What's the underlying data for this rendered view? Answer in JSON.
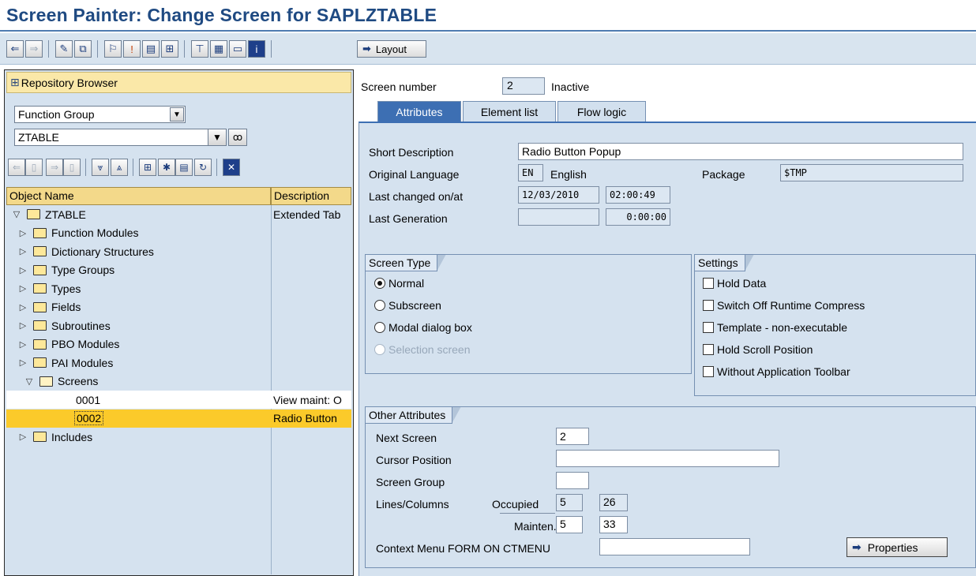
{
  "window": {
    "title": "Screen Painter: Change Screen for SAPLZTABLE"
  },
  "toolbar": {
    "icons": [
      "back-arrow-icon",
      "forward-arrow-icon",
      "display-change-icon",
      "other-object-icon",
      "activate-icon",
      "where-used-icon",
      "check-icon",
      "object-list-icon",
      "navigate-icon",
      "hierarchy-icon",
      "screen-layout-icon",
      "element-list-icon",
      "info-icon"
    ],
    "layout_label": "Layout"
  },
  "repository": {
    "title": "Repository Browser",
    "object_type": "Function Group",
    "object_name": "ZTABLE",
    "columns": [
      "Object Name",
      "Description"
    ],
    "tree": [
      {
        "name": "ZTABLE",
        "description": "Extended Tab",
        "level": 0,
        "expanded": true,
        "kind": "folder"
      },
      {
        "name": "Function Modules",
        "description": "",
        "level": 1,
        "expanded": false,
        "kind": "folder"
      },
      {
        "name": "Dictionary Structures",
        "description": "",
        "level": 1,
        "expanded": false,
        "kind": "folder"
      },
      {
        "name": "Type Groups",
        "description": "",
        "level": 1,
        "expanded": false,
        "kind": "folder"
      },
      {
        "name": "Types",
        "description": "",
        "level": 1,
        "expanded": false,
        "kind": "folder"
      },
      {
        "name": "Fields",
        "description": "",
        "level": 1,
        "expanded": false,
        "kind": "folder"
      },
      {
        "name": "Subroutines",
        "description": "",
        "level": 1,
        "expanded": false,
        "kind": "folder"
      },
      {
        "name": "PBO Modules",
        "description": "",
        "level": 1,
        "expanded": false,
        "kind": "folder"
      },
      {
        "name": "PAI Modules",
        "description": "",
        "level": 1,
        "expanded": false,
        "kind": "folder"
      },
      {
        "name": "Screens",
        "description": "",
        "level": 1,
        "expanded": true,
        "kind": "folder-open"
      },
      {
        "name": "0001",
        "description": "View maint: O",
        "level": 2,
        "kind": "leaf"
      },
      {
        "name": "0002",
        "description": "Radio Button",
        "level": 2,
        "kind": "leaf",
        "selected": true
      },
      {
        "name": "Includes",
        "description": "",
        "level": 1,
        "expanded": false,
        "kind": "folder"
      }
    ]
  },
  "screen": {
    "number_label": "Screen number",
    "number": "2",
    "status": "Inactive",
    "tabs": [
      "Attributes",
      "Element list",
      "Flow logic"
    ],
    "active_tab": "Attributes"
  },
  "attributes": {
    "short_desc_label": "Short Description",
    "short_desc": "Radio Button Popup",
    "orig_lang_label": "Original Language",
    "orig_lang_code": "EN",
    "orig_lang_name": "English",
    "package_label": "Package",
    "package": "$TMP",
    "last_changed_label": "Last changed on/at",
    "last_changed_date": "12/03/2010",
    "last_changed_time": "02:00:49",
    "last_gen_label": "Last Generation",
    "last_gen_date": "",
    "last_gen_time": "0:00:00"
  },
  "screen_type": {
    "title": "Screen Type",
    "options": [
      {
        "label": "Normal",
        "checked": true,
        "enabled": true
      },
      {
        "label": "Subscreen",
        "checked": false,
        "enabled": true
      },
      {
        "label": "Modal dialog box",
        "checked": false,
        "enabled": true
      },
      {
        "label": "Selection screen",
        "checked": false,
        "enabled": false
      }
    ]
  },
  "settings": {
    "title": "Settings",
    "options": [
      {
        "label": "Hold Data",
        "checked": false
      },
      {
        "label": "Switch Off Runtime Compress",
        "checked": false
      },
      {
        "label": "Template - non-executable",
        "checked": false
      },
      {
        "label": "Hold Scroll Position",
        "checked": false
      },
      {
        "label": "Without Application Toolbar",
        "checked": false
      }
    ]
  },
  "other": {
    "title": "Other Attributes",
    "next_screen_label": "Next Screen",
    "next_screen": "2",
    "cursor_label": "Cursor Position",
    "cursor": "",
    "group_label": "Screen Group",
    "group": "",
    "lines_cols_label": "Lines/Columns",
    "occupied_label": "Occupied",
    "occupied_lines": "5",
    "occupied_cols": "26",
    "mainten_label": "Mainten.",
    "mainten_lines": "5",
    "mainten_cols": "33",
    "context_label": "Context Menu FORM ON CTMENU",
    "context": "",
    "properties_label": "Properties"
  }
}
